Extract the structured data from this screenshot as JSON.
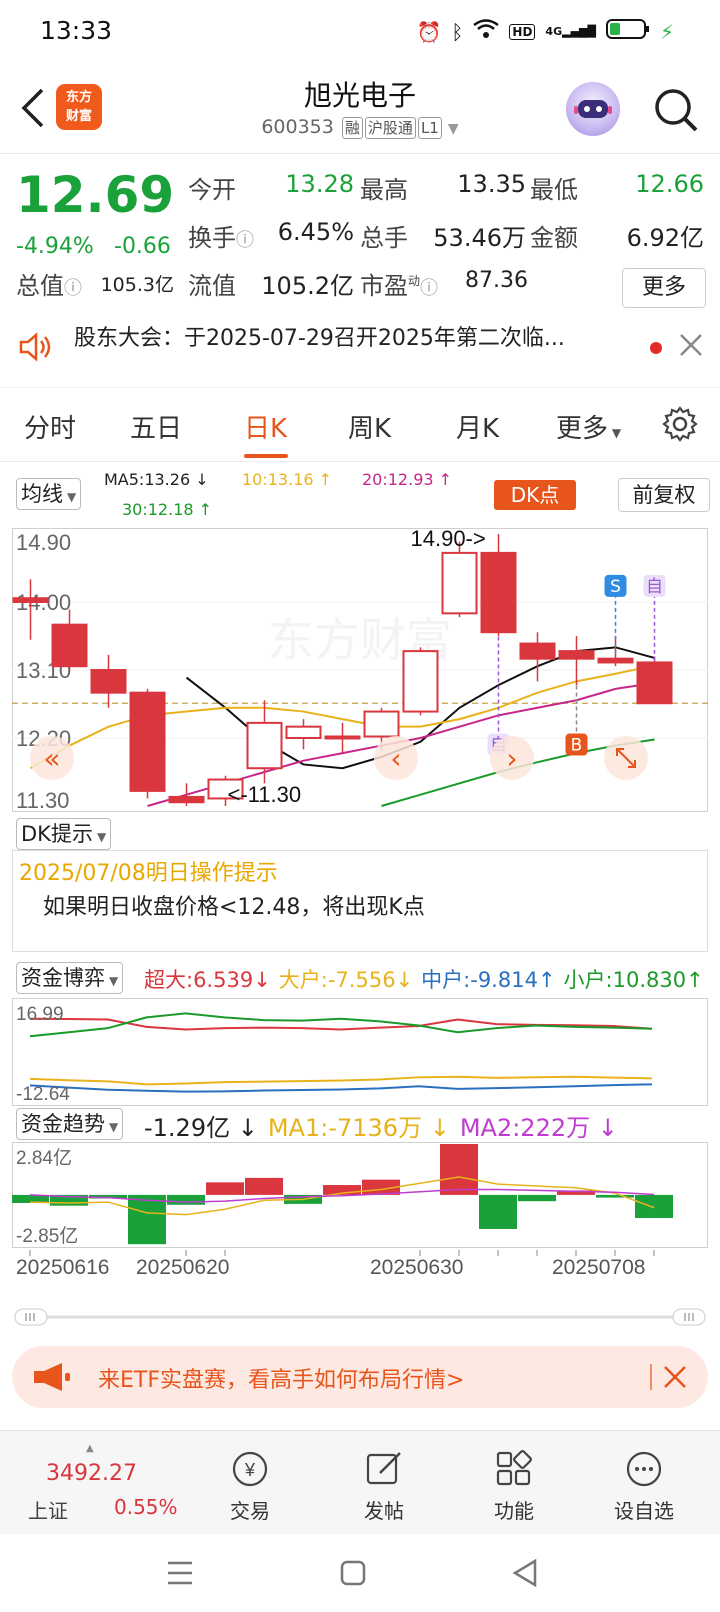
{
  "status": {
    "time": "13:33",
    "hd": "HD",
    "net": "4G"
  },
  "header": {
    "logo_line1": "东方",
    "logo_line2": "财富",
    "title": "旭光电子",
    "code": "600353",
    "tag1": "融",
    "tag2": "沪股通",
    "tag3": "L1"
  },
  "quote": {
    "price": "12.69",
    "pct": "-4.94%",
    "change": "-0.66",
    "open_lbl": "今开",
    "open": "13.28",
    "high_lbl": "最高",
    "high": "13.35",
    "low_lbl": "最低",
    "low": "12.66",
    "turnover_lbl": "换手",
    "turnover": "6.45%",
    "volume_lbl": "总手",
    "volume": "53.46万",
    "amount_lbl": "金额",
    "amount": "6.92亿",
    "mcap_lbl": "总值",
    "mcap": "105.3亿",
    "float_lbl": "流值",
    "float": "105.2亿",
    "pe_lbl": "市盈",
    "pe_sup": "动",
    "pe": "87.36",
    "more": "更多"
  },
  "notice": {
    "text": "股东大会：于2025-07-29召开2025年第二次临..."
  },
  "tabs": [
    "分时",
    "五日",
    "日K",
    "周K",
    "月K",
    "更多"
  ],
  "chart_controls": {
    "ma_select": "均线",
    "ma5": "MA5:13.26",
    "ma10": "10:13.16",
    "ma20": "20:12.93",
    "ma30": "30:12.18",
    "dk": "DK点",
    "fq": "前复权"
  },
  "chart_data": [
    {
      "type": "candlestick",
      "title": "日K",
      "y_ticks": [
        "14.90",
        "14.00",
        "13.10",
        "12.20",
        "11.30"
      ],
      "ylim": [
        11.3,
        14.9
      ],
      "annotations": [
        "14.90->",
        "<-11.30",
        "S",
        "自",
        "自",
        "B"
      ],
      "candles": [
        {
          "o": 14.05,
          "c": 14.0,
          "h": 14.3,
          "l": 13.5
        },
        {
          "o": 13.7,
          "c": 13.15,
          "h": 13.9,
          "l": 13.1
        },
        {
          "o": 13.1,
          "c": 12.8,
          "h": 13.3,
          "l": 12.6
        },
        {
          "o": 12.8,
          "c": 11.5,
          "h": 12.85,
          "l": 11.4
        },
        {
          "o": 11.42,
          "c": 11.35,
          "h": 11.6,
          "l": 11.3
        },
        {
          "o": 11.4,
          "c": 11.65,
          "h": 11.7,
          "l": 11.3
        },
        {
          "o": 11.8,
          "c": 12.4,
          "h": 12.7,
          "l": 11.6
        },
        {
          "o": 12.2,
          "c": 12.35,
          "h": 12.45,
          "l": 12.05
        },
        {
          "o": 12.2,
          "c": 12.22,
          "h": 12.4,
          "l": 12.0
        },
        {
          "o": 12.22,
          "c": 12.55,
          "h": 12.6,
          "l": 12.05
        },
        {
          "o": 12.55,
          "c": 13.35,
          "h": 13.4,
          "l": 12.5
        },
        {
          "o": 13.85,
          "c": 14.65,
          "h": 14.8,
          "l": 13.8
        },
        {
          "o": 14.65,
          "c": 13.6,
          "h": 14.9,
          "l": 13.55
        },
        {
          "o": 13.45,
          "c": 13.25,
          "h": 13.6,
          "l": 12.95
        },
        {
          "o": 13.35,
          "c": 13.25,
          "h": 13.55,
          "l": 12.9
        },
        {
          "o": 13.25,
          "c": 13.2,
          "h": 13.55,
          "l": 13.15
        },
        {
          "o": 13.2,
          "c": 12.66,
          "h": 13.28,
          "l": 12.66
        }
      ],
      "series": [
        {
          "name": "MA5",
          "color": "#111111",
          "values": [
            null,
            null,
            null,
            null,
            13.0,
            12.6,
            12.15,
            11.85,
            11.8,
            11.95,
            12.15,
            12.6,
            12.9,
            13.15,
            13.35,
            13.4,
            13.26
          ]
        },
        {
          "name": "MA10",
          "color": "#e8b21a",
          "values": [
            11.8,
            12.1,
            12.35,
            12.5,
            12.55,
            12.6,
            12.6,
            12.55,
            12.45,
            12.35,
            12.35,
            12.45,
            12.6,
            12.8,
            12.95,
            13.05,
            13.16
          ]
        },
        {
          "name": "MA20",
          "color": "#c8258a",
          "values": [
            null,
            null,
            null,
            11.3,
            11.45,
            11.6,
            11.75,
            11.9,
            12.0,
            12.1,
            12.2,
            12.35,
            12.5,
            12.6,
            12.7,
            12.85,
            12.93
          ]
        },
        {
          "name": "MA30",
          "color": "#1a9a2a",
          "values": [
            null,
            null,
            null,
            null,
            null,
            null,
            null,
            null,
            null,
            11.3,
            11.45,
            11.6,
            11.75,
            11.88,
            12.0,
            12.1,
            12.18
          ]
        }
      ]
    },
    {
      "type": "line",
      "title": "资金博弈",
      "y_ticks": [
        "16.99",
        "-12.64"
      ],
      "ylim": [
        -12.64,
        16.99
      ],
      "legend": [
        {
          "name": "超大",
          "value": ":6.539",
          "color": "#d9363e"
        },
        {
          "name": "大户",
          "value": ":-7.556",
          "color": "#e8b21a"
        },
        {
          "name": "中户",
          "value": ":-9.814",
          "color": "#2a6fc0"
        },
        {
          "name": "小户",
          "value": ":10.830",
          "color": "#1a9a2a"
        }
      ],
      "series": [
        {
          "name": "超大",
          "color": "#d9363e",
          "values": [
            14.5,
            14.4,
            14.2,
            11.5,
            10.5,
            11.0,
            11.2,
            11.0,
            10.5,
            11.2,
            11.8,
            14.2,
            12.5,
            12.2,
            12.1,
            11.8,
            10.8
          ]
        },
        {
          "name": "大户",
          "color": "#e8b21a",
          "values": [
            -7.8,
            -8.3,
            -8.7,
            -9.8,
            -9.5,
            -9.0,
            -8.8,
            -8.6,
            -8.4,
            -8.0,
            -7.2,
            -7.0,
            -7.4,
            -7.2,
            -7.0,
            -7.3,
            -7.6
          ]
        },
        {
          "name": "中户",
          "color": "#2a6fc0",
          "values": [
            -10.2,
            -11.0,
            -11.8,
            -12.2,
            -12.5,
            -12.4,
            -12.1,
            -11.9,
            -11.7,
            -11.3,
            -10.5,
            -11.5,
            -11.2,
            -10.9,
            -10.5,
            -10.1,
            -9.8
          ]
        },
        {
          "name": "小户",
          "color": "#1a9a2a",
          "values": [
            8.0,
            9.5,
            11.0,
            15.0,
            16.5,
            15.0,
            14.0,
            13.8,
            14.5,
            13.5,
            12.0,
            9.5,
            11.0,
            12.0,
            11.5,
            11.2,
            10.8
          ]
        }
      ]
    },
    {
      "type": "bar",
      "title": "资金趋势",
      "value": "-1.29亿",
      "legend": [
        {
          "name": "MA1",
          "value": ":-7136万",
          "color": "#e8b21a"
        },
        {
          "name": "MA2",
          "value": ":222万",
          "color": "#c03cd0"
        }
      ],
      "y_ticks": [
        "2.84亿",
        "-2.85亿"
      ],
      "ylim": [
        -2.85,
        2.84
      ],
      "x_ticks": [
        "20250616",
        "20250620",
        "20250630",
        "20250708"
      ],
      "values": [
        -0.45,
        -0.6,
        -0.2,
        -2.75,
        -0.55,
        0.7,
        0.95,
        -0.5,
        0.55,
        0.85,
        2.84,
        -1.9,
        -0.35,
        0.25,
        -0.15,
        -1.29
      ],
      "series": [
        {
          "name": "MA1",
          "color": "#e8b21a",
          "values": [
            -0.4,
            -0.45,
            -0.4,
            -1.0,
            -1.1,
            -0.8,
            -0.3,
            -0.25,
            0.1,
            0.3,
            1.0,
            0.6,
            0.5,
            0.4,
            0.1,
            -0.71
          ]
        },
        {
          "name": "MA2",
          "color": "#c03cd0",
          "values": [
            0.0,
            -0.1,
            -0.15,
            -0.3,
            -0.4,
            -0.35,
            -0.2,
            -0.1,
            -0.05,
            0.05,
            0.3,
            0.3,
            0.25,
            0.2,
            0.15,
            0.02
          ]
        }
      ]
    }
  ],
  "dk_hint": {
    "select": "DK提示",
    "date_line": "2025/07/08明日操作提示",
    "text": "如果明日收盘价格<12.48，将出现K点"
  },
  "fund_select": "资金博弈",
  "trend_select": "资金趋势",
  "banner": {
    "text": "来ETF实盘赛，看高手如何布局行情>"
  },
  "bottom_nav": {
    "index_value": "3492.27",
    "index_name": "上证",
    "index_pct": "0.55%",
    "items": [
      "交易",
      "发帖",
      "功能",
      "设自选"
    ]
  }
}
